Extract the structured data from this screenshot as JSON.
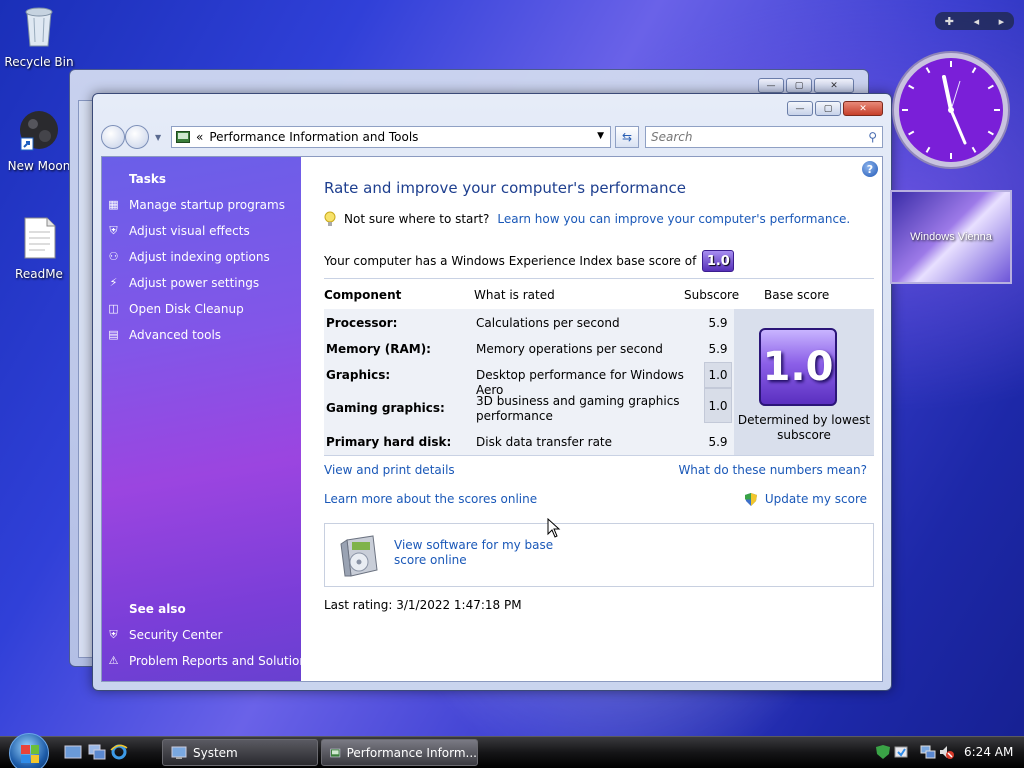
{
  "desktop": {
    "icons": [
      {
        "label": "Recycle Bin"
      },
      {
        "label": "New Moon"
      },
      {
        "label": "ReadMe"
      }
    ]
  },
  "window": {
    "address_prefix": "«",
    "address_text": "Performance Information and Tools",
    "search_placeholder": "Search"
  },
  "sidebar": {
    "tasks_heading": "Tasks",
    "tasks": [
      {
        "label": "Manage startup programs",
        "icon": "startup-icon"
      },
      {
        "label": "Adjust visual effects",
        "icon": "shield-icon"
      },
      {
        "label": "Adjust indexing options",
        "icon": "indexing-icon"
      },
      {
        "label": "Adjust power settings",
        "icon": "power-icon"
      },
      {
        "label": "Open Disk Cleanup",
        "icon": "disk-cleanup-icon"
      },
      {
        "label": "Advanced tools",
        "icon": "tools-icon"
      }
    ],
    "see_also_heading": "See also",
    "see_also": [
      {
        "label": "Security Center",
        "icon": "shield-icon"
      },
      {
        "label": "Problem Reports and Solutions",
        "icon": "problem-reports-icon"
      }
    ]
  },
  "main": {
    "title": "Rate and improve your computer's performance",
    "tip_text": "Not sure where to start?",
    "tip_link": "Learn how you can improve your computer's performance.",
    "score_line": "Your computer has a Windows Experience Index base score of",
    "base_score": "1.0",
    "headers": {
      "component": "Component",
      "what": "What is rated",
      "subscore": "Subscore",
      "base": "Base score"
    },
    "rows": [
      {
        "component": "Processor:",
        "what": "Calculations per second",
        "subscore": "5.9"
      },
      {
        "component": "Memory (RAM):",
        "what": "Memory operations per second",
        "subscore": "5.9"
      },
      {
        "component": "Graphics:",
        "what": "Desktop performance for Windows Aero",
        "subscore": "1.0"
      },
      {
        "component": "Gaming graphics:",
        "what": "3D business and gaming graphics performance",
        "subscore": "1.0"
      },
      {
        "component": "Primary hard disk:",
        "what": "Disk data transfer rate",
        "subscore": "5.9"
      }
    ],
    "base_caption": "Determined by lowest subscore",
    "view_print": "View and print details",
    "what_numbers": "What do these numbers mean?",
    "learn_more": "Learn more about the scores online",
    "update_score": "Update my score",
    "software_link": "View software for my base score online",
    "last_rating": "Last rating: 3/1/2022 1:47:18 PM"
  },
  "gadgets": {
    "slideshow_text": "Windows Vienna"
  },
  "taskbar": {
    "tasks": [
      {
        "label": "System"
      },
      {
        "label": "Performance Inform..."
      }
    ],
    "time": "6:24 AM"
  },
  "colors": {
    "accent_link": "#1a58b8",
    "title_blue": "#1e3f8f",
    "sidebar_purple": "#8256e8"
  }
}
